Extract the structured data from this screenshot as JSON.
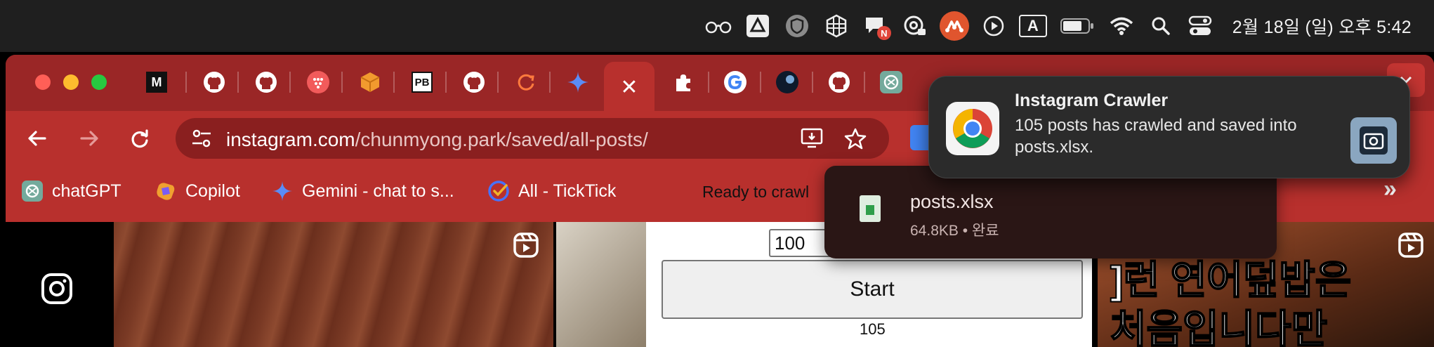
{
  "menubar": {
    "icons": [
      "glasses-icon",
      "google-drive-icon",
      "shield-icon",
      "grid-app-icon",
      "chat-badge-icon",
      "at-lock-icon",
      "mindmap-app-icon",
      "play-icon",
      "input-method-icon",
      "battery-icon",
      "wifi-icon",
      "spotlight-search-icon",
      "control-center-icon"
    ],
    "input_method_label": "A",
    "chat_badge": "N",
    "clock": "2월 18일 (일) 오후 5:42"
  },
  "tabs": {
    "active_close": "✕",
    "favicons": [
      "medium-icon",
      "github-icon",
      "github-icon",
      "dots-app-icon",
      "box-icon",
      "pb-icon",
      "github-icon",
      "refresh-app-icon",
      "gemini-icon",
      "extension-icon",
      "google-icon",
      "dark-orb-icon",
      "github-icon",
      "chatgpt-icon"
    ],
    "pb_label": "PB",
    "medium_label": "M"
  },
  "toolbar": {
    "url_host": "instagram.com",
    "url_path": "/chunmyong.park/saved/all-posts/"
  },
  "bookmarks": [
    {
      "label": "chatGPT",
      "icon": "chatgpt-icon",
      "color": "#74aa9c"
    },
    {
      "label": "Copilot",
      "icon": "copilot-icon",
      "color": "#f0a030"
    },
    {
      "label": "Gemini - chat to s...",
      "icon": "gemini-icon",
      "color": "#4f86f7"
    },
    {
      "label": "All - TickTick",
      "icon": "ticktick-icon",
      "color": "#4772fa"
    }
  ],
  "bookmarks_overflow": "»",
  "crawler": {
    "ready_text": "Ready to crawl",
    "input_value": "100",
    "start_label": "Start",
    "count": "105"
  },
  "post3_text": [
    "]런 연어덮밥은",
    "처음입니다만"
  ],
  "download": {
    "filename": "posts.xlsx",
    "meta": "64.8KB • 완료"
  },
  "notification": {
    "title": "Instagram Crawler",
    "body": "105 posts has crawled and saved into posts.xlsx."
  },
  "colors": {
    "tab_strip": "#9a2626",
    "toolbar": "#b8302d",
    "omnibox": "#8a1f1f"
  }
}
